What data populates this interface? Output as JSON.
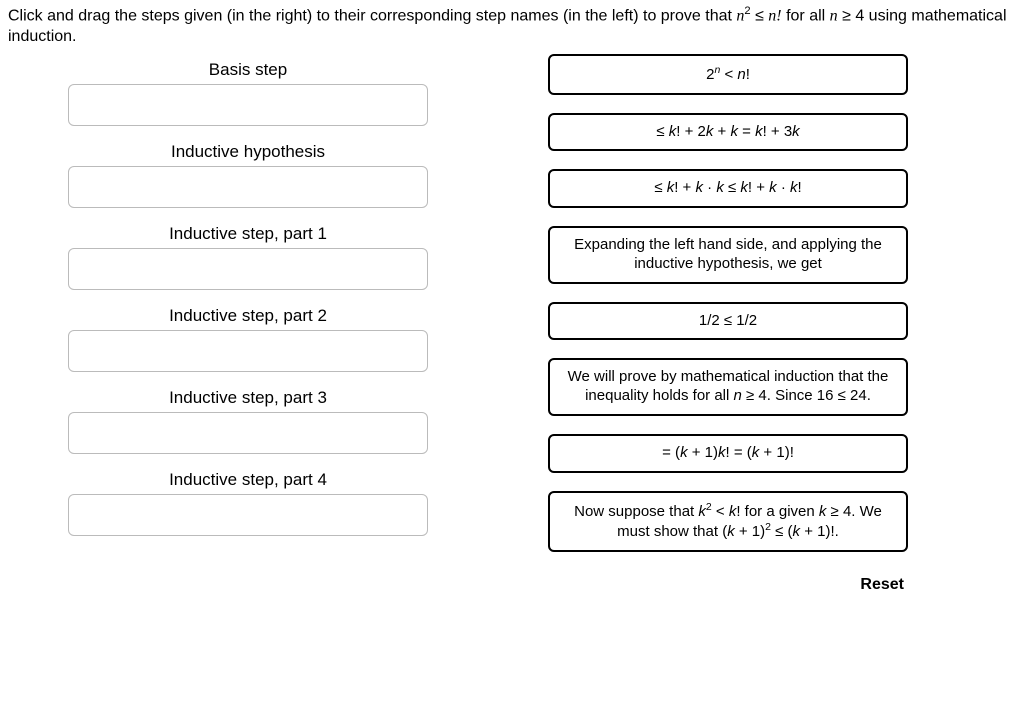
{
  "instructions": {
    "prefix": "Click and drag the steps given (in the right) to their corresponding step names (in the left) to prove that ",
    "expr_left_var": "n",
    "expr_left_sup": "2",
    "expr_rel": " ≤ ",
    "expr_right": "n!",
    "mid": " for all ",
    "cond_var": "n",
    "cond_rest": " ≥ 4",
    "suffix": " using mathematical induction."
  },
  "left": {
    "labels": [
      "Basis step",
      "Inductive hypothesis",
      "Inductive step, part 1",
      "Inductive step, part 2",
      "Inductive step, part 3",
      "Inductive step, part 4"
    ]
  },
  "right": {
    "items": [
      {
        "html": "2<sup><span class=\"ital\">n</span></sup> &lt; <span class=\"ital\">n</span>!"
      },
      {
        "html": "≤ <span class=\"ital\">k</span>! + 2<span class=\"ital\">k</span> + <span class=\"ital\">k</span> = <span class=\"ital\">k</span>! + 3<span class=\"ital\">k</span>"
      },
      {
        "html": "≤ <span class=\"ital\">k</span>! + <span class=\"ital\">k</span> · <span class=\"ital\">k</span> ≤ <span class=\"ital\">k</span>! + <span class=\"ital\">k</span> · <span class=\"ital\">k</span>!"
      },
      {
        "html": "Expanding the left hand side, and applying the inductive hypothesis, we get"
      },
      {
        "html": "1/2 ≤ 1/2"
      },
      {
        "html": "We will prove by mathematical induction that the inequality holds for all <span class=\"ital\">n</span> ≥ 4. Since 16 ≤ 24."
      },
      {
        "html": "= (<span class=\"ital\">k</span> + 1)<span class=\"ital\">k</span>! = (<span class=\"ital\">k</span> + 1)!"
      },
      {
        "html": "Now suppose that <span class=\"ital\">k</span><sup>2</sup> &lt; <span class=\"ital\">k</span>! for a given <span class=\"ital\">k</span> ≥ 4. We must show that (<span class=\"ital\">k</span> + 1)<sup>2</sup> ≤ (<span class=\"ital\">k</span> + 1)!."
      }
    ]
  },
  "reset_label": "Reset"
}
